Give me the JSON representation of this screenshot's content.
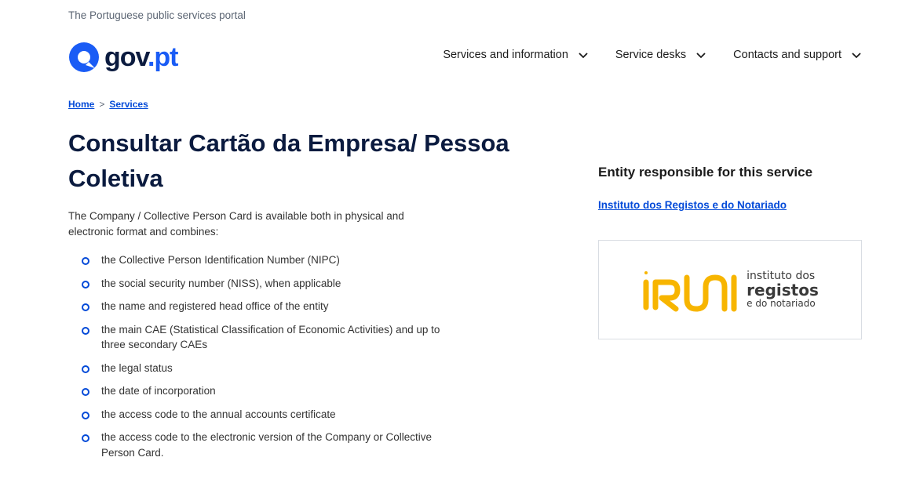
{
  "header": {
    "tagline": "The Portuguese public services portal",
    "logo": {
      "prefix": "gov",
      "suffix": ".pt",
      "icon": "speech-bubble-icon",
      "brand_color": "#1a5cf5",
      "dark_color": "#0b1b3f"
    },
    "nav": [
      {
        "label": "Services and information",
        "icon": "chevron-down-icon"
      },
      {
        "label": "Service desks",
        "icon": "chevron-down-icon"
      },
      {
        "label": "Contacts and support",
        "icon": "chevron-down-icon"
      }
    ]
  },
  "breadcrumb": {
    "items": [
      {
        "label": "Home"
      },
      {
        "label": "Services"
      }
    ],
    "separator": ">"
  },
  "main": {
    "title": "Consultar Cartão da Empresa/ Pessoa Coletiva",
    "intro": "The Company / Collective Person Card is available both in physical and electronic format and combines:",
    "bullets": [
      "the Collective Person Identification Number (NIPC)",
      "the social security number (NISS), when applicable",
      "the name and registered head office of the entity",
      "the main CAE (Statistical Classification of Economic Activities) and up to three secondary CAEs",
      "the legal status",
      "the date of incorporation",
      "the access code to the annual accounts certificate",
      "the access code to the electronic version of the Company or Collective Person Card."
    ]
  },
  "aside": {
    "heading": "Entity responsible for this service",
    "entity_link": "Instituto dos Registos e do Notariado",
    "entity_logo": {
      "mark": "iRN",
      "line1": "instituto dos",
      "line2": "registos",
      "line3": "e do notariado",
      "mark_color": "#f7b500"
    }
  },
  "colors": {
    "link": "#034ad8",
    "title": "#0b1b3f",
    "bullet": "#034ad8"
  }
}
